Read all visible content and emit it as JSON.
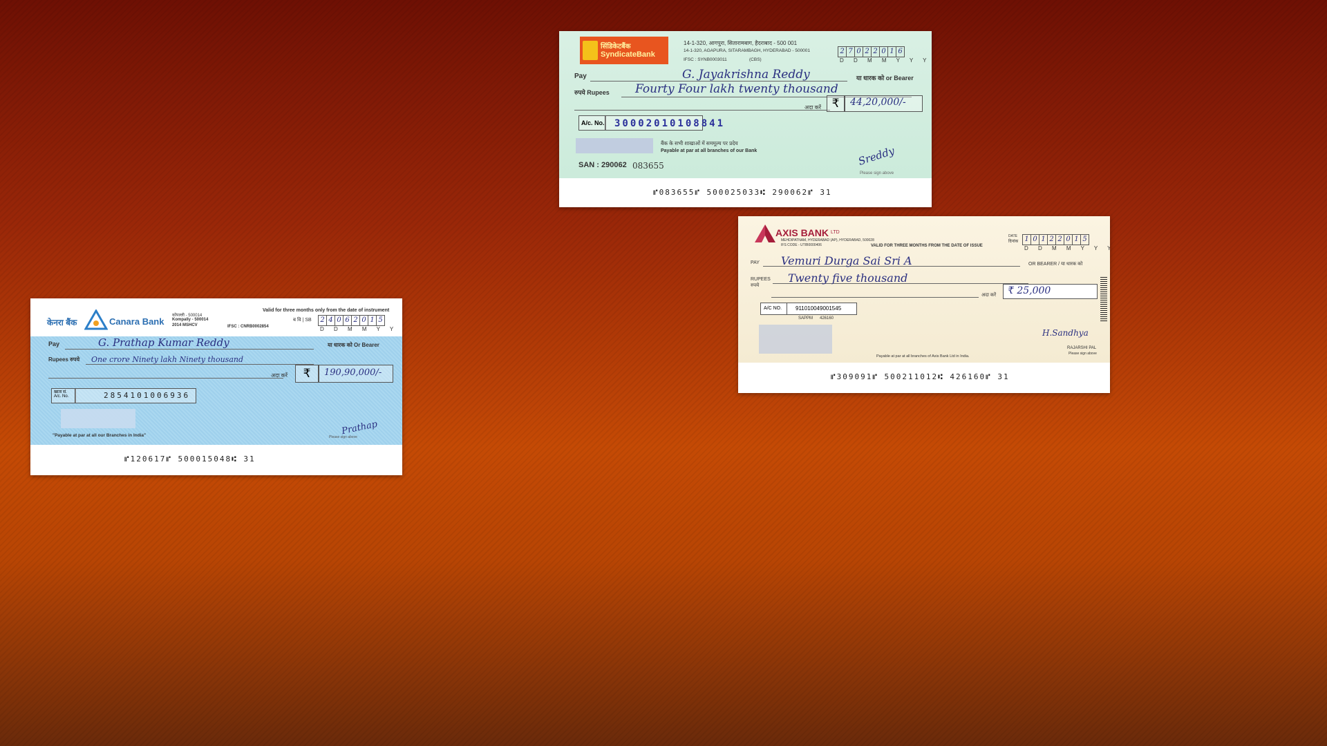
{
  "syndicate": {
    "logo_hindi": "सिंडिकेटबैंक",
    "logo_text": "SyndicateBank",
    "address_hindi": "14-1-320, आगपुरा, सितारामबाग, हैदराबाद - 500 001",
    "address": "14-1-320, AGAPURA, SITARAMBAGH, HYDERABAD - 500001",
    "ifsc": "IFSC : SYNB0003011",
    "cbs": "(CBS)",
    "date_digits": [
      "2",
      "7",
      "0",
      "2",
      "2",
      "0",
      "1",
      "6"
    ],
    "date_format": "D D M M Y Y Y Y",
    "pay_label": "Pay",
    "payee": "G. Jayakrishna Reddy",
    "bearer": "या धारक को or Bearer",
    "rupees_label": "रुपये Rupees",
    "amount_words": "Fourty Four lakh twenty thousand",
    "ada_karen": "अदा करें",
    "rupee_symbol": "₹",
    "amount": "44,20,000/-",
    "ac_label": "A/c. No.",
    "ac_number": "30002010108841",
    "payable_hindi": "बैंक के सभी शाखाओं में सममूल्य पर प्रदेय",
    "payable": "Payable at par at all branches of our Bank",
    "san": "SAN : 290062",
    "san_number": "083655",
    "signature": "Sreddy",
    "sign_above": "Please sign above",
    "micr": "⑈083655⑈  500025033⑆  290062⑈  31"
  },
  "axis": {
    "logo_text": "AXIS BANK",
    "logo_suffix": "LTD",
    "address": "MEHDIPATNAM, HYDERABAD (AP), HYDERABAD, 500028",
    "ifs": "IFS CODE - UTIB0000406",
    "validity": "VALID FOR THREE MONTHS FROM THE DATE OF ISSUE",
    "date_label": "DATE",
    "date_label_hindi": "दिनांक",
    "date_digits": [
      "1",
      "0",
      "1",
      "2",
      "2",
      "0",
      "1",
      "5"
    ],
    "date_format": "D D M M Y Y Y Y",
    "pay_label": "PAY",
    "payee": "Vemuri Durga Sai Sri A",
    "bearer": "OR BEARER / या धारक को",
    "rupees_label": "RUPEES",
    "rupees_hindi": "रुपये",
    "amount_words": "Twenty five thousand",
    "ada_karen": "अदा करें",
    "amount": "₹ 25,000",
    "ac_label": "A/C NO.",
    "ac_number": "911010049001545",
    "sappm": "SAPPM",
    "sappm_code": "426160",
    "payable": "Payable at par at all branches of Axis Bank Ltd in India.",
    "signature": "H.Sandhya",
    "signatory": "RAJARSHI PAL",
    "sign_above": "Please sign above",
    "micr": "⑈309091⑈  500211012⑆  426160⑈  31"
  },
  "canara": {
    "logo_hindi": "केनरा बैंक",
    "logo_text": "Canara Bank",
    "branch_hindi": "कोंपल्ली - 500014",
    "branch": "Kompally - 500014",
    "code": "2014 MSHCV",
    "ifsc": "IFSC : CNRB0002854",
    "validity": "Valid for three months only from the date of instrument",
    "sb_label": "ब वि | SB",
    "date_digits": [
      "2",
      "4",
      "0",
      "6",
      "2",
      "0",
      "1",
      "5"
    ],
    "date_format": "D D M M Y Y Y Y",
    "pay_label": "Pay",
    "payee": "G. Prathap Kumar Reddy",
    "bearer": "या धारक को Or Bearer",
    "rupees_label": "Rupees रुपये",
    "amount_words": "One crore Ninety lakh Ninety thousand",
    "ada_karen": "अदा करें",
    "rupee_symbol": "₹",
    "amount": "190,90,000/-",
    "ac_label_hindi": "खाता सं.",
    "ac_label": "A/c. No.",
    "ac_number": "2854101006936",
    "payable": "\"Payable at par at all our Branches in India\"",
    "signature": "Prathap",
    "sign_above": "Please sign above",
    "micr": "⑈120617⑈  500015048⑆          31"
  }
}
